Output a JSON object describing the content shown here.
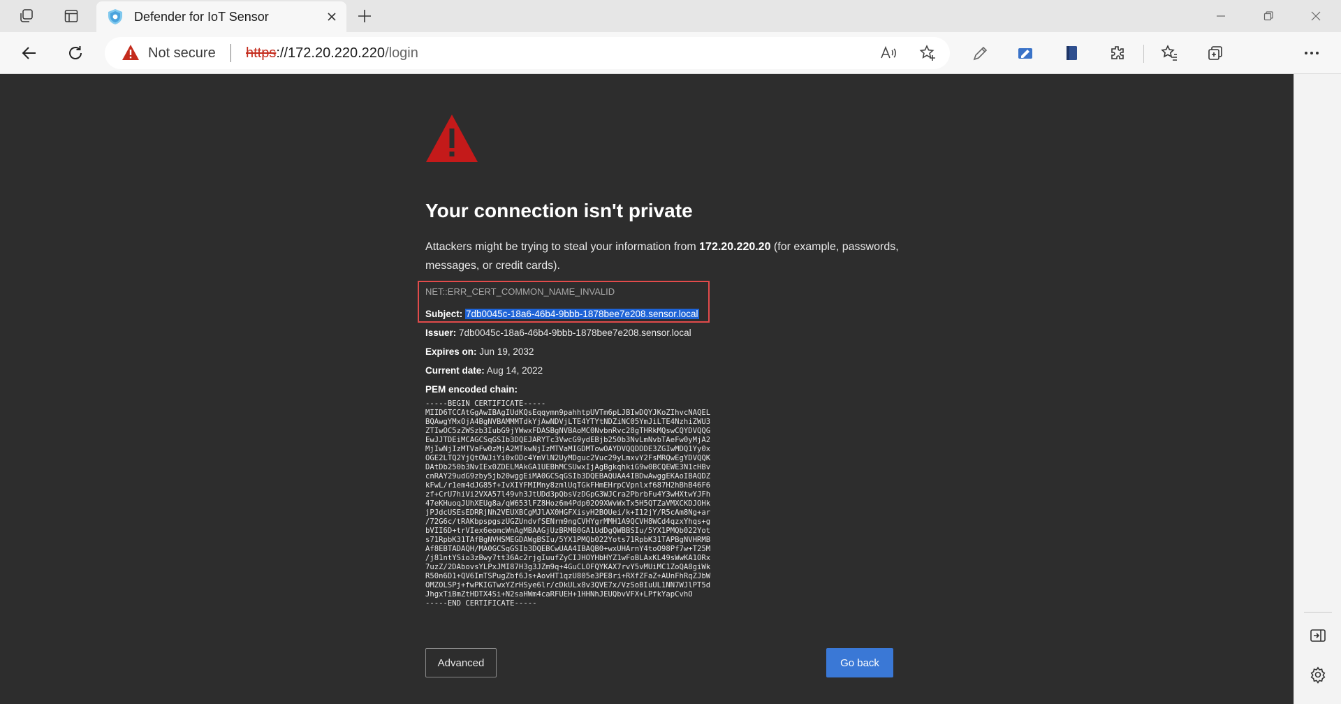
{
  "browser": {
    "tab": {
      "title": "Defender for IoT Sensor",
      "favicon": "shield-icon"
    },
    "address": {
      "security_label": "Not secure",
      "url_scheme": "https",
      "url_host": "://172.20.220.220",
      "url_path": "/login"
    },
    "colors": {
      "warning": "#c42b1c",
      "primary_button": "#3a78d6",
      "selection": "#1e63d6"
    }
  },
  "error_page": {
    "title": "Your connection isn't private",
    "desc_before": "Attackers might be trying to steal your information from ",
    "host": "172.20.220.20",
    "desc_after": " (for example, passwords, messages, or credit cards).",
    "error_code": "NET::ERR_CERT_COMMON_NAME_INVALID",
    "subject_label": "Subject:",
    "subject_value": "7db0045c-18a6-46b4-9bbb-1878bee7e208.sensor.local",
    "issuer_label": "Issuer:",
    "issuer_value": "7db0045c-18a6-46b4-9bbb-1878bee7e208.sensor.local",
    "expires_label": "Expires on:",
    "expires_value": "Jun 19, 2032",
    "current_label": "Current date:",
    "current_value": "Aug 14, 2022",
    "pem_label": "PEM encoded chain:",
    "pem_lines": [
      "-----BEGIN CERTIFICATE-----",
      "MIID6TCCAtGgAwIBAgIUdKQsEqqymn9pahhtpUVTm6pLJBIwDQYJKoZIhvcNAQEL",
      "BQAwgYMxOjA4BgNVBAMMMTdkYjAwNDVjLTE4YTYtNDZiNC05YmJiLTE4NzhiZWU3",
      "ZTIwOC5zZWSzb3IubG9jYWwxFDASBgNVBAoMC0NvbnRvc28gTHRkMQswCQYDVQQG",
      "EwJJTDEiMCAGCSqGSIb3DQEJARYTc3VwcG9ydEBjb250b3NvLmNvbTAeFw0yMjA2",
      "MjIwNjIzMTVaFw0zMjA2MTkwNjIzMTVaMIGDMTowOAYDVQQDDDE3ZGIwMDQ1Yy0x",
      "OGE2LTQ2YjQtOWJiYi0xODc4YmVlN2UyMDguc2Vuc29yLmxvY2FsMRQwEgYDVQQK",
      "DAtDb250b3NvIEx0ZDELMAkGA1UEBhMCSUwxIjAgBgkqhkiG9w0BCQEWE3N1cHBv",
      "cnRAY29udG9zby5jb20wggEiMA0GCSqGSIb3DQEBAQUAA4IBDwAwggEKAoIBAQDZ",
      "kFwL/r1em4dJG85f+IvXIYFMIMny8zmlUqTGkFHmEHrpCVpnlxf687H2hBhB46F6",
      "zf+CrU7hiVi2VXA57l49vh3JtUDd3pQbsVzDGpG3WJCra2PbrbFu4Y3wHXtwYJFh",
      "47eKHuoqJUhXEUg8a/qW653lFZ8Hoz6m4Pdp02O9XWvWxTx5H5QTZaVMXCKDJOHk",
      "jPJdcUSEsEDRRjNh2VEUXBCgMJlAX0HGFXisyH2BOUei/k+I12jY/R5cAm8Ng+ar",
      "/72G6c/tRAKbpspgszUGZUndvfSENrm9ngCVHYgrMMH1A9QCVH8WCd4qzxYhqs+g",
      "bVII6D+trVIex6eomcWnAgMBAAGjUzBRMB0GA1UdDgQWBBSIu/5YX1PMQb022Yot",
      "s71RpbK31TAfBgNVHSMEGDAWgBSIu/5YX1PMQb022Yots71RpbK31TAPBgNVHRMB",
      "Af8EBTADAQH/MA0GCSqGSIb3DQEBCwUAA4IBAQB0+wxUHArnY4toO98Pf7w+T25M",
      "/j81ntYSio3zBwy7tt36Ac2rjgIuufZyCIJHOYHbHYZ1wFoBLAxKL49sWwKA1ORx",
      "7uzZ/2DAbovsYLPxJMI87H3g3JZm9q+4GuCLOFQYKAX7rvY5vMUiMC1ZoQA8giWk",
      "R50n6D1+QV6ImTSPugZbf6Js+AovHT1qzU805e3PE8ri+RXfZFaZ+AUnFhRqZJbW",
      "OMZOLSPj+fwPKIGTwxYZrHSye6lr/cDkULx8v3QVE7x/VzSoBIuUL1NN7WJlPT5d",
      "JhgxTiBmZtHDTX4Si+N2saHWm4caRFUEH+1HHNhJEUQbvVFX+LPfkYapCvhO",
      "-----END CERTIFICATE-----"
    ],
    "advanced_label": "Advanced",
    "go_back_label": "Go back"
  }
}
